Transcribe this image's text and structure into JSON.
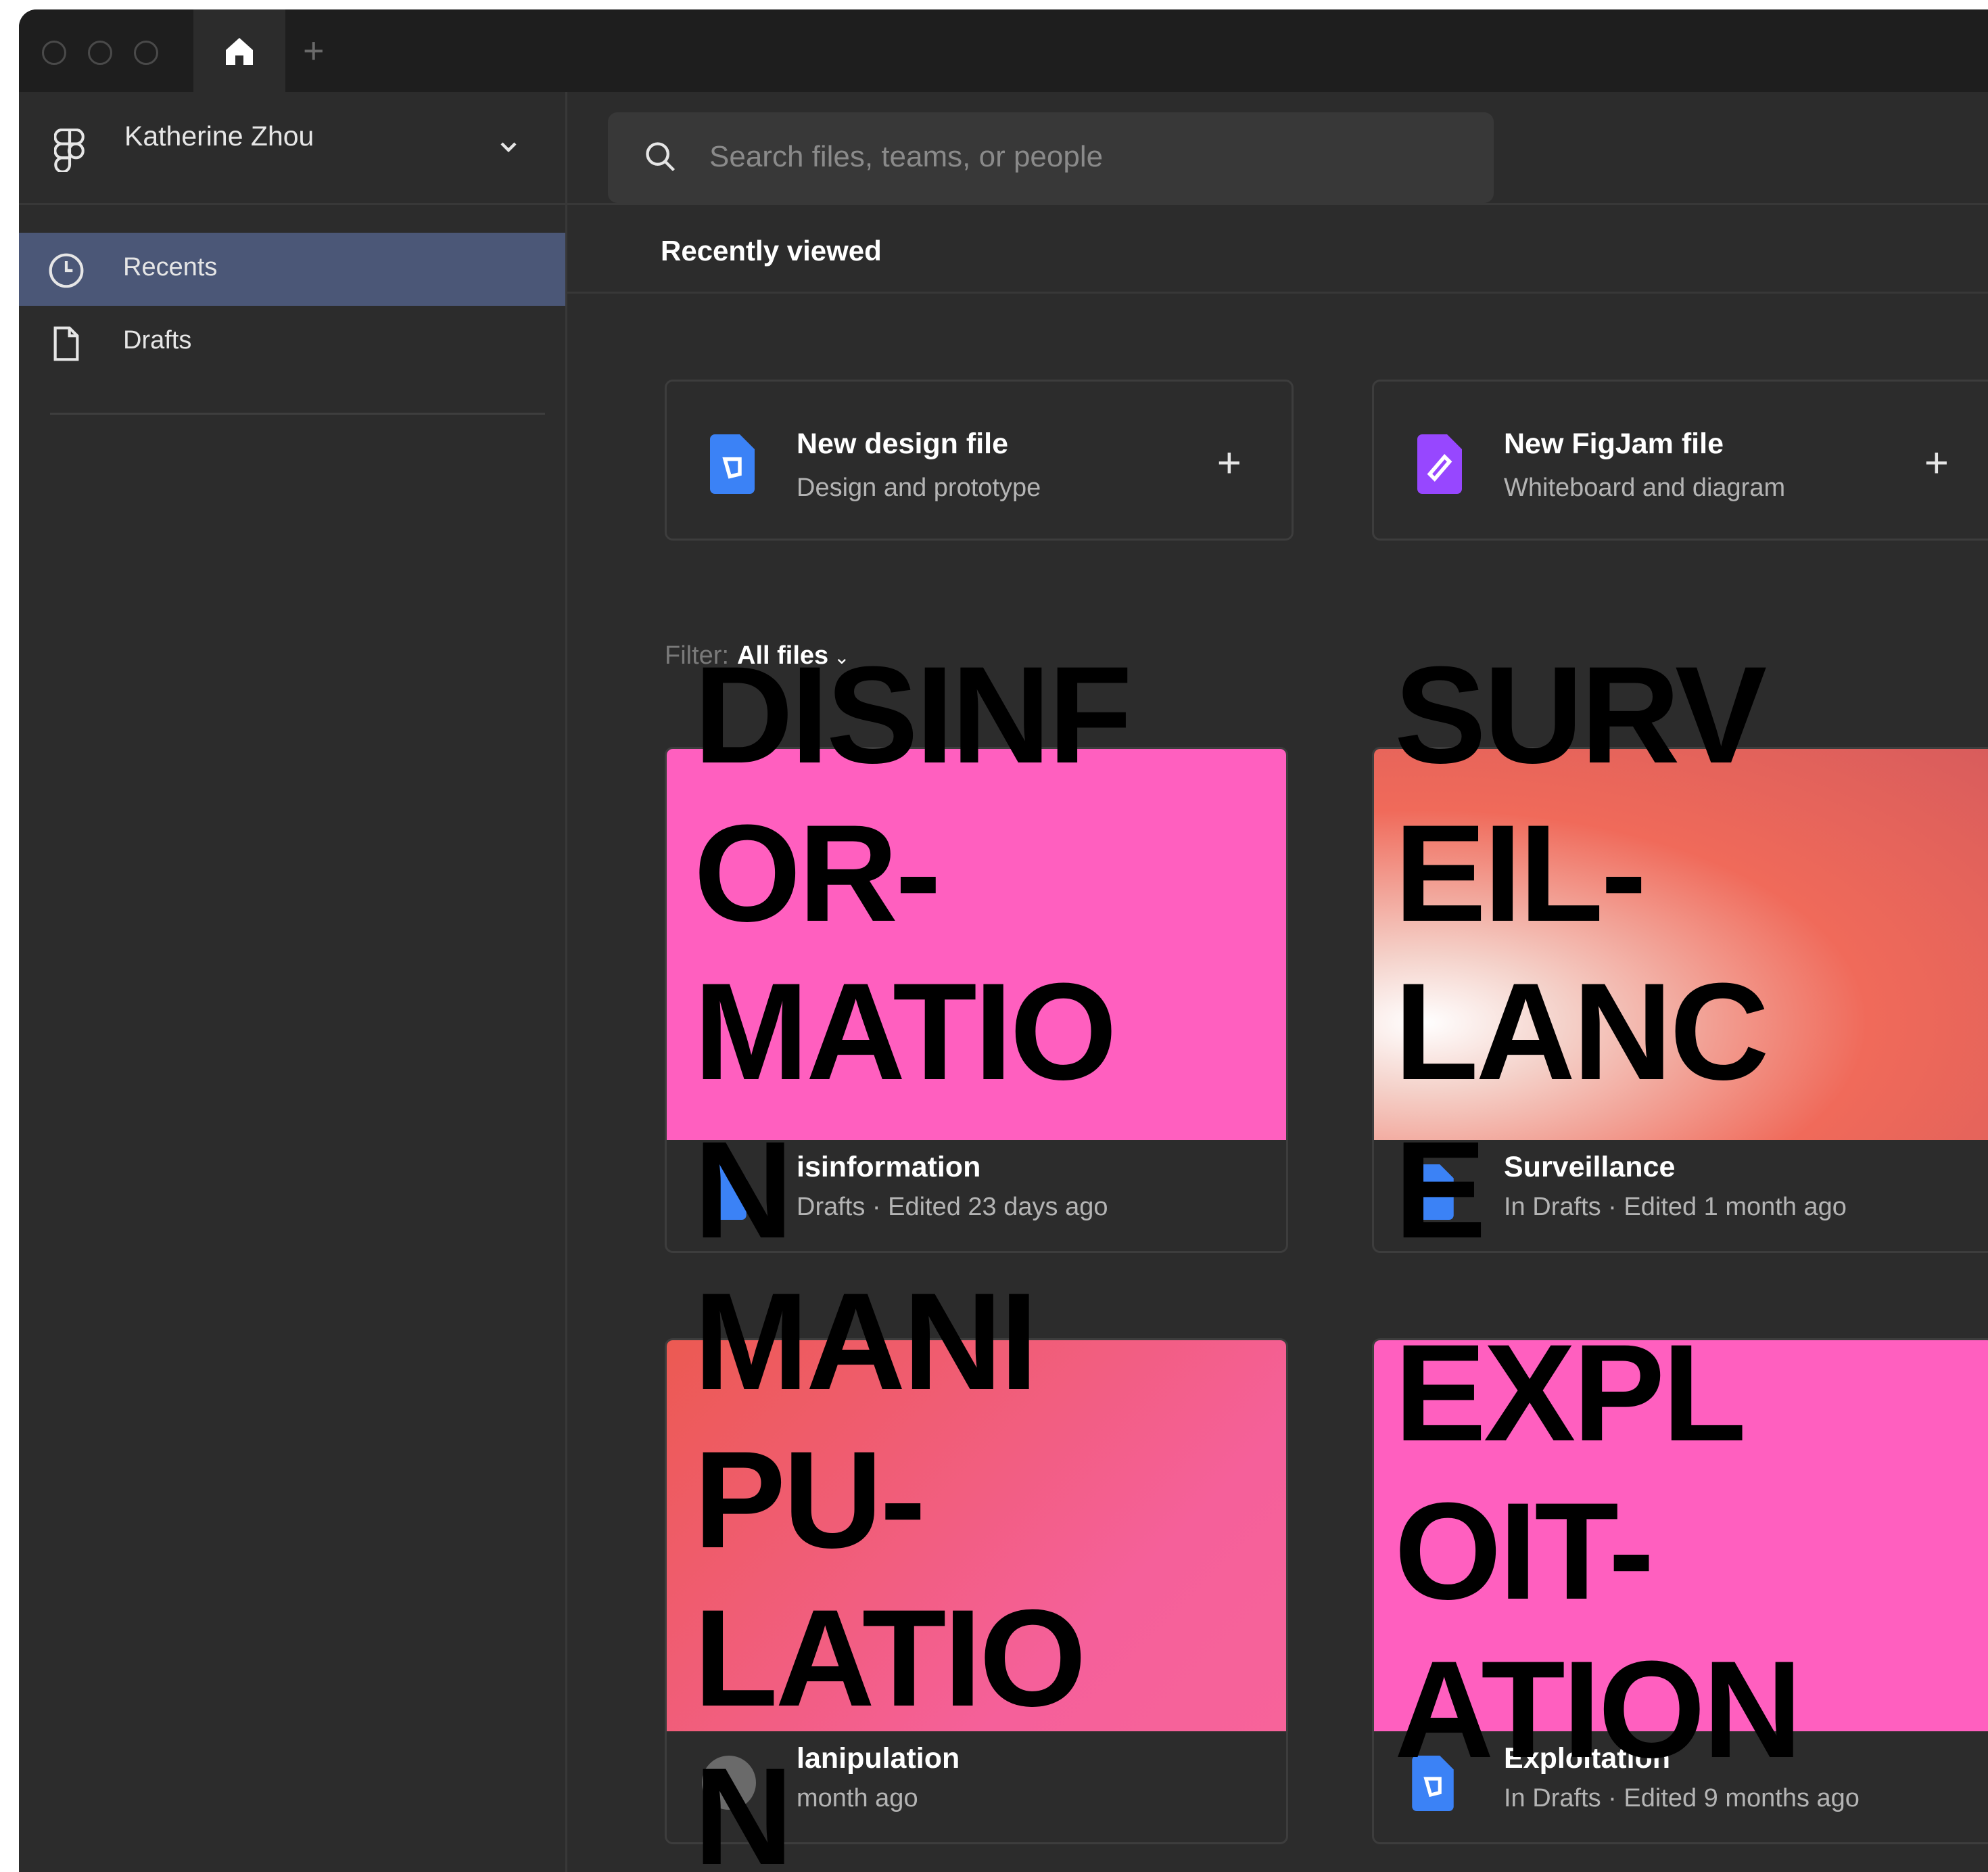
{
  "titlebar": {
    "tabs": [
      {
        "icon": "home-icon"
      }
    ],
    "new_tab_label": "+"
  },
  "account": {
    "name": "Katherine Zhou",
    "icon": "figma-logo-icon"
  },
  "sidebar": {
    "items": [
      {
        "label": "Recents",
        "icon": "clock-icon",
        "active": true
      },
      {
        "label": "Drafts",
        "icon": "file-icon",
        "active": false
      }
    ]
  },
  "search": {
    "placeholder": "Search files, teams, or people"
  },
  "main": {
    "section_title": "Recently viewed"
  },
  "create_cards": [
    {
      "title": "New design file",
      "subtitle": "Design and prototype",
      "icon": "design-file-icon",
      "color": "#3b82f6",
      "plus": "+"
    },
    {
      "title": "New FigJam file",
      "subtitle": "Whiteboard and diagram",
      "icon": "figjam-file-icon",
      "color": "#9747ff",
      "plus": "+"
    }
  ],
  "filter": {
    "label": "Filter:",
    "value": "All files"
  },
  "files": [
    {
      "name": "isinformation",
      "meta": "Drafts · Edited 23 days ago",
      "thumb_color": "#ff5fbf"
    },
    {
      "name": "Surveillance",
      "meta": "In Drafts · Edited 1 month ago",
      "thumb_color": "#e65a5a"
    },
    {
      "name": "lanipulation",
      "meta": "month ago",
      "thumb_color": "#f0605e"
    },
    {
      "name": "Exploitation",
      "meta": "In Drafts · Edited 9 months ago",
      "thumb_color": "#ff5fbf"
    }
  ],
  "overlays": [
    "DISINF\nOR-\nMATIO\nN",
    "SURV\nEIL-\nLANC\nE",
    "MANI\nPU-\nLATIO\nN",
    "EXPL\nOIT-\nATION"
  ],
  "colors": {
    "sidebar_active": "#4b5777",
    "background": "#2c2c2c",
    "titlebar": "#1e1e1e"
  }
}
